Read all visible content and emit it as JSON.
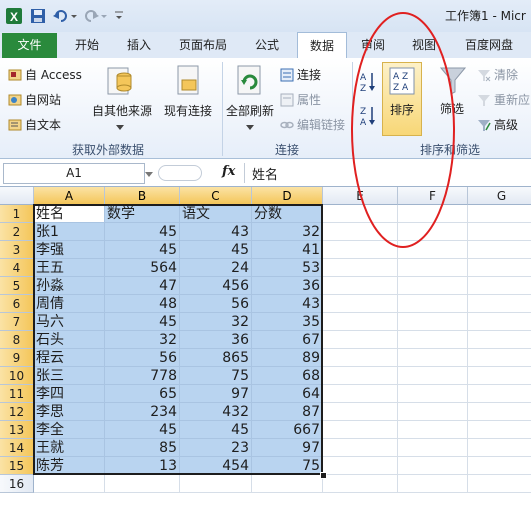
{
  "window": {
    "title": "工作簿1 - Micr"
  },
  "qat": {
    "app_icon": "excel-icon",
    "save_icon": "save-icon",
    "undo_icon": "undo-icon",
    "redo_icon": "redo-icon"
  },
  "tabs": [
    {
      "label": "文件"
    },
    {
      "label": "开始"
    },
    {
      "label": "插入"
    },
    {
      "label": "页面布局"
    },
    {
      "label": "公式"
    },
    {
      "label": "数据"
    },
    {
      "label": "审阅"
    },
    {
      "label": "视图"
    },
    {
      "label": "百度网盘"
    }
  ],
  "ribbon": {
    "external": {
      "access": "自 Access",
      "web": "自网站",
      "text": "自文本",
      "other": "自其他来源",
      "existing": "现有连接",
      "group": "获取外部数据"
    },
    "connections": {
      "refresh_all": "全部刷新",
      "connections": "连接",
      "properties": "属性",
      "edit_links": "编辑链接",
      "group": "连接"
    },
    "sort_filter": {
      "sort": "排序",
      "filter": "筛选",
      "clear": "清除",
      "reapply": "重新应",
      "advanced": "高级",
      "group": "排序和筛选"
    }
  },
  "formula_bar": {
    "name_box": "A1",
    "fx": "fx",
    "content": "姓名"
  },
  "grid": {
    "columns": [
      "A",
      "B",
      "C",
      "D",
      "E",
      "F",
      "G"
    ],
    "rows": [
      [
        "姓名",
        "数学",
        "语文",
        "分数"
      ],
      [
        "张1",
        "45",
        "43",
        "32"
      ],
      [
        "李强",
        "45",
        "45",
        "41"
      ],
      [
        "王五",
        "564",
        "24",
        "53"
      ],
      [
        "孙淼",
        "47",
        "456",
        "36"
      ],
      [
        "周倩",
        "48",
        "56",
        "43"
      ],
      [
        "马六",
        "45",
        "32",
        "35"
      ],
      [
        "石头",
        "32",
        "36",
        "67"
      ],
      [
        "程云",
        "56",
        "865",
        "89"
      ],
      [
        "张三",
        "778",
        "75",
        "68"
      ],
      [
        "李四",
        "65",
        "97",
        "64"
      ],
      [
        "李思",
        "234",
        "432",
        "87"
      ],
      [
        "李全",
        "45",
        "45",
        "667"
      ],
      [
        "王就",
        "85",
        "23",
        "97"
      ],
      [
        "陈芳",
        "13",
        "454",
        "75"
      ],
      [
        "",
        "",
        "",
        ""
      ]
    ],
    "row_numbers": [
      "1",
      "2",
      "3",
      "4",
      "5",
      "6",
      "7",
      "8",
      "9",
      "10",
      "11",
      "12",
      "13",
      "14",
      "15",
      "16"
    ]
  },
  "colors": {
    "file_tab": "#2a8a3c",
    "selection": "#b9d4f0",
    "header_highlight": "#f4c65a",
    "annotation": "#e02020"
  }
}
